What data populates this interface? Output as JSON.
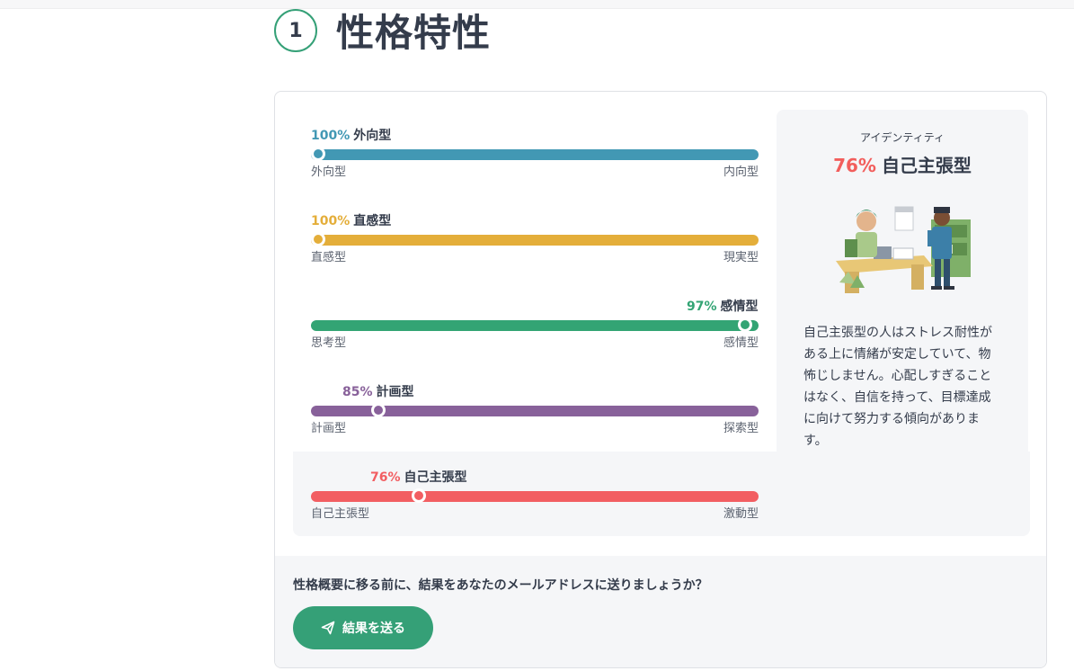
{
  "section": {
    "number": "1",
    "title": "性格特性"
  },
  "traits": [
    {
      "pct": "100%",
      "name": "外向型",
      "left": "外向型",
      "right": "内向型",
      "color": "#4298b4",
      "value": 100,
      "knob_fraction": 0.0,
      "label_align": "left"
    },
    {
      "pct": "100%",
      "name": "直感型",
      "left": "直感型",
      "right": "現実型",
      "color": "#e4ae3a",
      "value": 100,
      "knob_fraction": 0.0,
      "label_align": "left"
    },
    {
      "pct": "97%",
      "name": "感情型",
      "left": "思考型",
      "right": "感情型",
      "color": "#33a474",
      "value": 97,
      "knob_fraction": 0.97,
      "label_align": "right"
    },
    {
      "pct": "85%",
      "name": "計画型",
      "left": "計画型",
      "right": "探索型",
      "color": "#88619a",
      "value": 85,
      "knob_fraction": 0.15,
      "label_align": "left"
    },
    {
      "pct": "76%",
      "name": "自己主張型",
      "left": "自己主張型",
      "right": "激動型",
      "color": "#f25e62",
      "value": 76,
      "knob_fraction": 0.24,
      "label_align": "left"
    }
  ],
  "identity": {
    "subtitle": "アイデンティティ",
    "pct": "76%",
    "name": "自己主張型",
    "description": "自己主張型の人はストレス耐性がある上に情緒が安定していて、物怖じしません。心配しすぎることはなく、自信を持って、目標達成に向けて努力する傾向があります。"
  },
  "footer": {
    "question": "性格概要に移る前に、結果をあなたのメールアドレスに送りましょうか？",
    "button_label": "結果を送る"
  }
}
